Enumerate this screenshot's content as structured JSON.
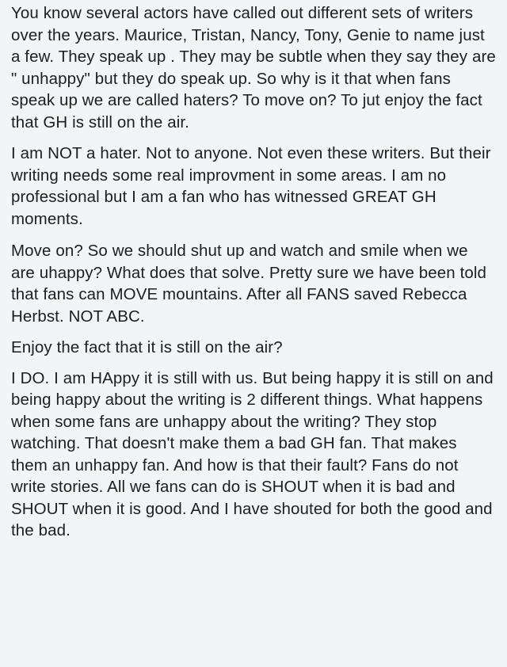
{
  "post": {
    "paragraphs": [
      "You know several actors have called out different sets of writers over the years. Maurice, Tristan, Nancy, Tony, Genie to name just a few. They speak up . They may be subtle when they say they are \" unhappy\" but they do speak up. So why is it that when fans speak up we are called haters? To move on? To jut enjoy the fact that GH is still on the air.",
      "I am NOT a hater. Not to anyone. Not even these writers. But their writing needs some real improvment in some areas. I am no professional but I am a fan who has witnessed GREAT GH moments.",
      "Move on? So we should shut up and watch and smile when we are uhappy? What does that solve. Pretty sure we have been told that fans can MOVE mountains. After all FANS saved Rebecca Herbst. NOT ABC.",
      "Enjoy the fact that it is still on the air?",
      "I DO. I am HAppy it is still with us. But being happy it is still on and being happy about the writing is 2 different things. What happens when some fans are unhappy about the writing? They stop watching. That doesn't make them a bad GH fan. That makes them an unhappy fan. And how is that their fault? Fans do not write stories. All we fans can do is SHOUT when it is bad and SHOUT when it is good. And I have shouted for both the good and the bad."
    ]
  }
}
